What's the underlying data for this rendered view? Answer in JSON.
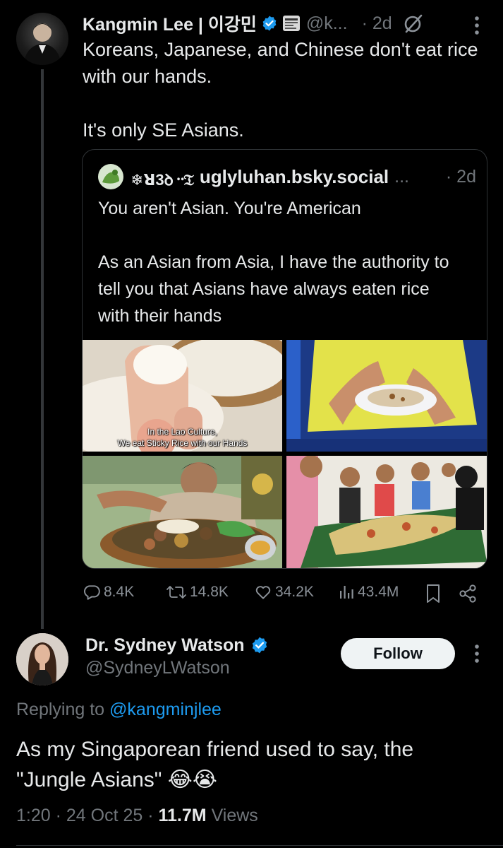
{
  "main_tweet": {
    "author_name": "Kangmin Lee | 이강민",
    "handle": "@k...",
    "time": "· 2d",
    "body": "Koreans, Japanese, and Chinese don't eat rice with our hands.\n\nIt's only SE Asians.",
    "stats": {
      "replies": "8.4K",
      "reposts": "14.8K",
      "likes": "34.2K",
      "views": "43.4M"
    }
  },
  "quoted_tweet": {
    "display_name": "❄ꓤ3ꝺ᠃𝔗",
    "handle": "uglyluhan.bsky.social",
    "ellipsis": "...",
    "time": "· 2d",
    "body": "You aren't Asian. You're American\n\nAs an Asian from Asia, I have the authority to tell you that Asians have always eaten rice with their hands",
    "image_caption": "In the Lao Culture,\nWe eat Sticky Rice with our Hands"
  },
  "reply_tweet": {
    "author_name": "Dr. Sydney Watson",
    "handle": "@SydneyLWatson",
    "follow_label": "Follow",
    "replying_prefix": "Replying to",
    "replying_to": "@kangminjlee",
    "body": "As my Singaporean friend used to say, the \"Jungle Asians\" 😂😭",
    "time": "1:20 · 24 Oct 25 ·",
    "views_count": "11.7M",
    "views_label": "Views"
  },
  "colors": {
    "background": "#000000",
    "text": "#e7e9ea",
    "muted": "#71767b",
    "link": "#1d9bf0",
    "verified": "#1d9bf0"
  }
}
